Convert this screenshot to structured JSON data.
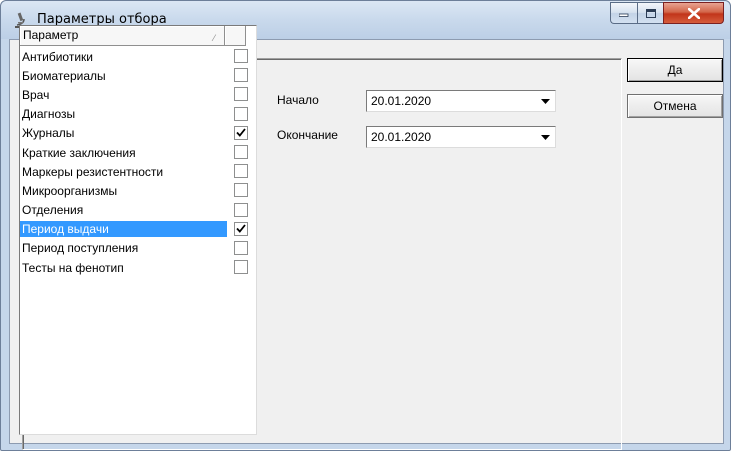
{
  "window": {
    "title": "Параметры отбора"
  },
  "list": {
    "column_header": "Параметр",
    "items": [
      {
        "label": "Антибиотики",
        "checked": false,
        "selected": false
      },
      {
        "label": "Биоматериалы",
        "checked": false,
        "selected": false
      },
      {
        "label": "Врач",
        "checked": false,
        "selected": false
      },
      {
        "label": "Диагнозы",
        "checked": false,
        "selected": false
      },
      {
        "label": "Журналы",
        "checked": true,
        "selected": false
      },
      {
        "label": "Краткие заключения",
        "checked": false,
        "selected": false
      },
      {
        "label": "Маркеры резистентности",
        "checked": false,
        "selected": false
      },
      {
        "label": "Микроорганизмы",
        "checked": false,
        "selected": false
      },
      {
        "label": "Отделения",
        "checked": false,
        "selected": false
      },
      {
        "label": "Период выдачи",
        "checked": true,
        "selected": true
      },
      {
        "label": "Период поступления",
        "checked": false,
        "selected": false
      },
      {
        "label": "Тесты на фенотип",
        "checked": false,
        "selected": false
      }
    ]
  },
  "period": {
    "start_label": "Начало",
    "start_value": "20.01.2020",
    "end_label": "Окончание",
    "end_value": "20.01.2020"
  },
  "buttons": {
    "ok_label": "Да",
    "cancel_label": "Отмена"
  },
  "colors": {
    "selection": "#3399ff",
    "titlebar": "#c9d9ec",
    "close_button": "#c2351a"
  }
}
